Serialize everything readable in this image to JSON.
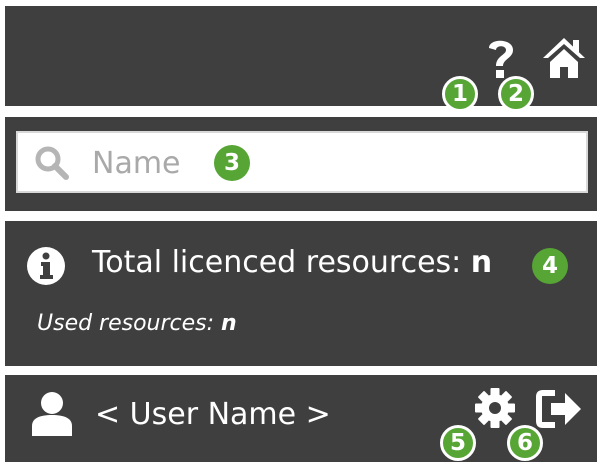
{
  "header": {
    "icons": [
      "help-icon",
      "home-icon"
    ],
    "badges": [
      "1",
      "2"
    ]
  },
  "search": {
    "placeholder": "Name",
    "icon": "search-icon",
    "badge": "3"
  },
  "info": {
    "icon": "info-icon",
    "total_label": "Total licenced resources: ",
    "total_value": "n",
    "used_label": "Used resources: ",
    "used_value": "n",
    "badge": "4"
  },
  "user": {
    "icon": "user-icon",
    "name": "< User Name >",
    "settings_icon": "gear-icon",
    "logout_icon": "logout-icon",
    "badges": [
      "5",
      "6"
    ]
  },
  "colors": {
    "panel": "#3f3f3f",
    "badge": "#56a535",
    "text": "#ffffff",
    "placeholder": "#a9a9a9"
  }
}
